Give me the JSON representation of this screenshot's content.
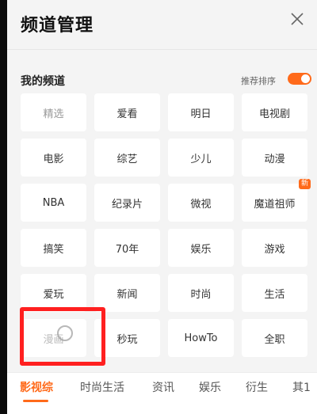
{
  "header": {
    "title": "频道管理",
    "close_icon": "close-icon"
  },
  "my_channels": {
    "title": "我的频道",
    "sort_label": "推荐排序",
    "sort_toggle_on": true,
    "items": [
      {
        "label": "精选"
      },
      {
        "label": "爱看"
      },
      {
        "label": "明日"
      },
      {
        "label": "电视剧"
      },
      {
        "label": "电影"
      },
      {
        "label": "综艺"
      },
      {
        "label": "少儿"
      },
      {
        "label": "动漫"
      },
      {
        "label": "NBA"
      },
      {
        "label": "纪录片"
      },
      {
        "label": "微视"
      },
      {
        "label": "魔道祖师",
        "badge": "新"
      },
      {
        "label": "搞笑"
      },
      {
        "label": "70年"
      },
      {
        "label": "娱乐"
      },
      {
        "label": "游戏"
      },
      {
        "label": "爱玩"
      },
      {
        "label": "新闻"
      },
      {
        "label": "时尚"
      },
      {
        "label": "生活"
      },
      {
        "label": "漫画"
      },
      {
        "label": "秒玩"
      },
      {
        "label": "HowTo"
      },
      {
        "label": "全职"
      }
    ]
  },
  "bottom_tabs": [
    {
      "label": "影视综",
      "active": true
    },
    {
      "label": "时尚生活"
    },
    {
      "label": "资讯"
    },
    {
      "label": "娱乐"
    },
    {
      "label": "衍生"
    },
    {
      "label": "其1"
    }
  ],
  "colors": {
    "accent": "#ff6a1a",
    "highlight_box": "#ff2020"
  }
}
